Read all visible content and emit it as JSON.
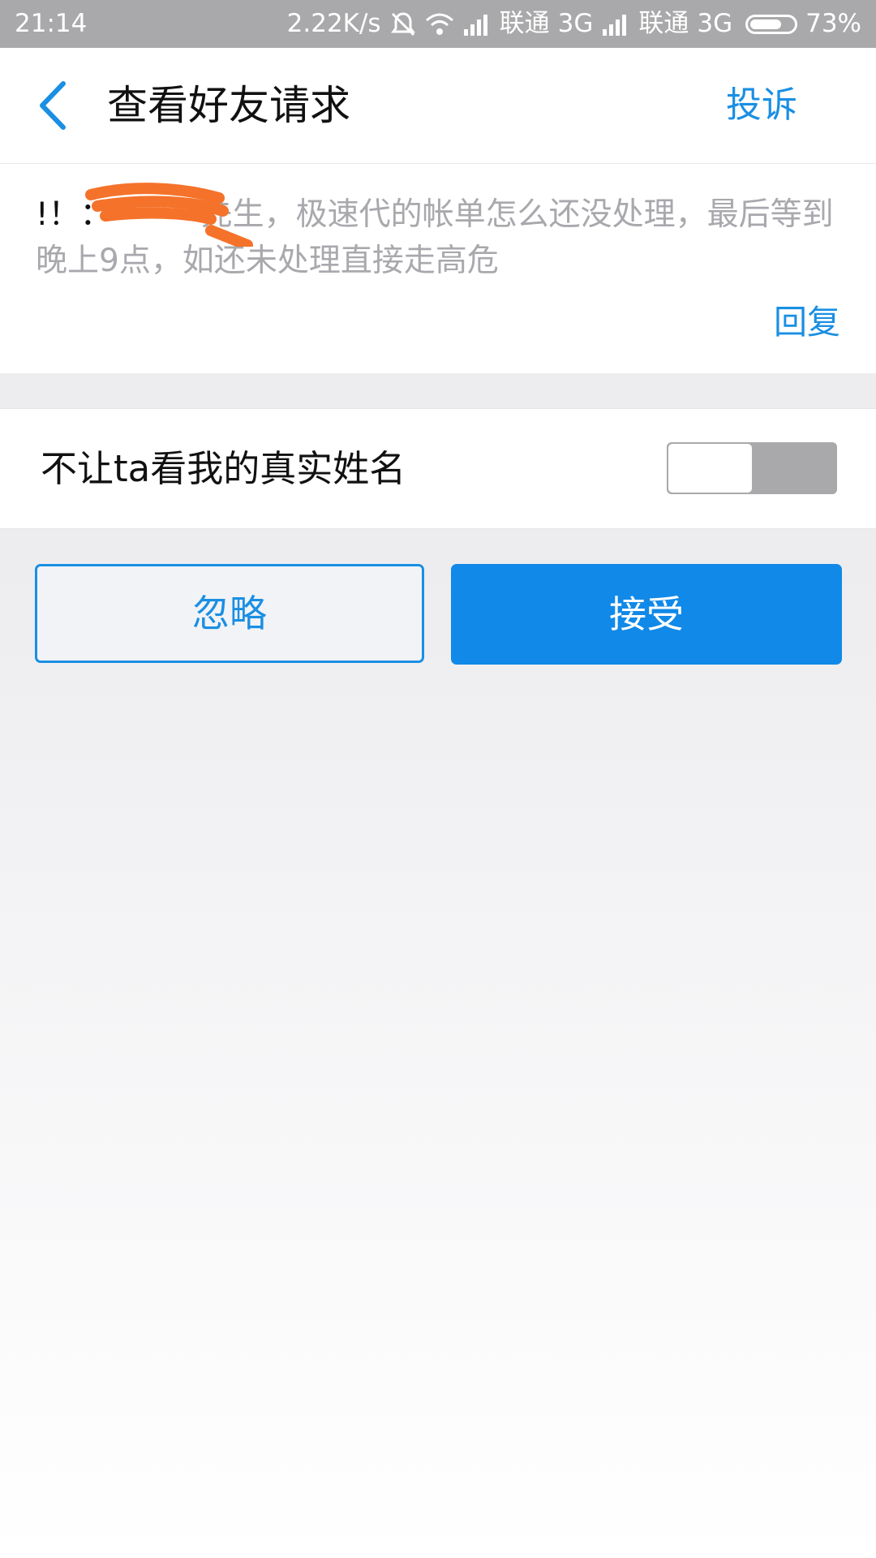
{
  "status_bar": {
    "time": "21:14",
    "network_speed": "2.22K/s",
    "carrier_1": "联通",
    "network_type_1": "3G",
    "carrier_2": "联通",
    "network_type_2": "3G",
    "battery_percent": "73%",
    "battery_level": 0.73,
    "icons": [
      "alarm-off-icon",
      "wifi-icon",
      "signal-icon",
      "signal-icon",
      "battery-icon"
    ]
  },
  "nav": {
    "back_icon": "chevron-left-icon",
    "title": "查看好友请求",
    "complain_label": "投诉"
  },
  "message": {
    "sender_prefix": "!！：",
    "body": "先生，极速代的帐单怎么还没处理，最后等到晚上9点，如还未处理直接走高危",
    "reply_label": "回复"
  },
  "privacy": {
    "label": "不让ta看我的真实姓名",
    "toggle_on": false
  },
  "actions": {
    "ignore_label": "忽略",
    "accept_label": "接受"
  },
  "colors": {
    "accent": "#1a8fe3",
    "accept_bg": "#1189e8",
    "status_bar_bg": "#a9a9ab",
    "redaction": "#f5722a"
  }
}
